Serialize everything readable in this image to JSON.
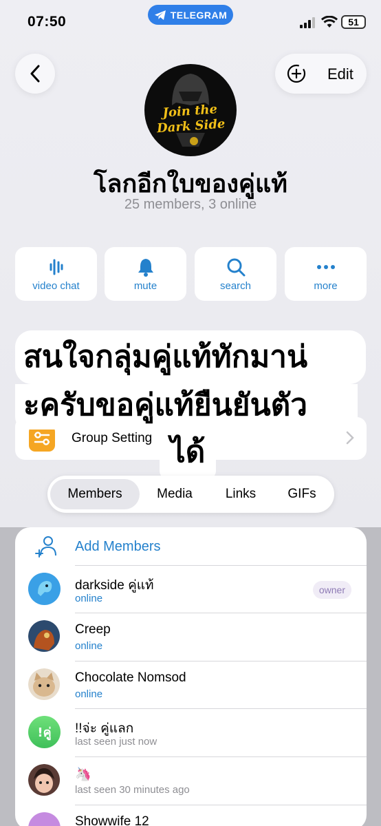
{
  "status_bar": {
    "time": "07:50",
    "app_pill": "TELEGRAM",
    "battery": "51"
  },
  "nav": {
    "edit_label": "Edit"
  },
  "group": {
    "avatar_text_line1": "Join the",
    "avatar_text_line2": "Dark Side",
    "title": "โลกอีกใบของคู่แท้",
    "subtitle": "25 members, 3 online"
  },
  "actions": [
    {
      "label": "video chat",
      "icon": "waveform-icon"
    },
    {
      "label": "mute",
      "icon": "bell-icon"
    },
    {
      "label": "search",
      "icon": "search-icon"
    },
    {
      "label": "more",
      "icon": "more-icon"
    }
  ],
  "settings": {
    "label": "Group Setting"
  },
  "overlay": {
    "line1": "สนใจกลุ่มคู่แท้ทักมาน่",
    "line2": "ะครับขอคู่แท้ยืนยันตัว",
    "line3": "ได้"
  },
  "tabs": [
    "Members",
    "Media",
    "Links",
    "GIFs"
  ],
  "members_section": {
    "add_label": "Add Members",
    "members": [
      {
        "name": "darkside คู่แท้",
        "status": "online",
        "badge": "owner",
        "avatar_color": "#3aa0e6"
      },
      {
        "name": "Creep",
        "status": "online",
        "avatar_color": "#2c4a6e"
      },
      {
        "name": "Chocolate Nomsod",
        "status": "online",
        "avatar_color": "#d9c3a4"
      },
      {
        "name": "!!จ่ะ คู่แลก",
        "status": "last seen just now",
        "avatar_letters": "!คู่",
        "avatar_color": "#4cd060"
      },
      {
        "name": "🦄",
        "status": "last seen 30 minutes ago",
        "avatar_color": "#5a3b35"
      },
      {
        "name": "Showwife 12",
        "status": "",
        "avatar_color": "#c58be0"
      }
    ]
  },
  "colors": {
    "accent": "#2481cc",
    "telegram_pill": "#2f7fe8",
    "settings_icon": "#f5a623"
  }
}
